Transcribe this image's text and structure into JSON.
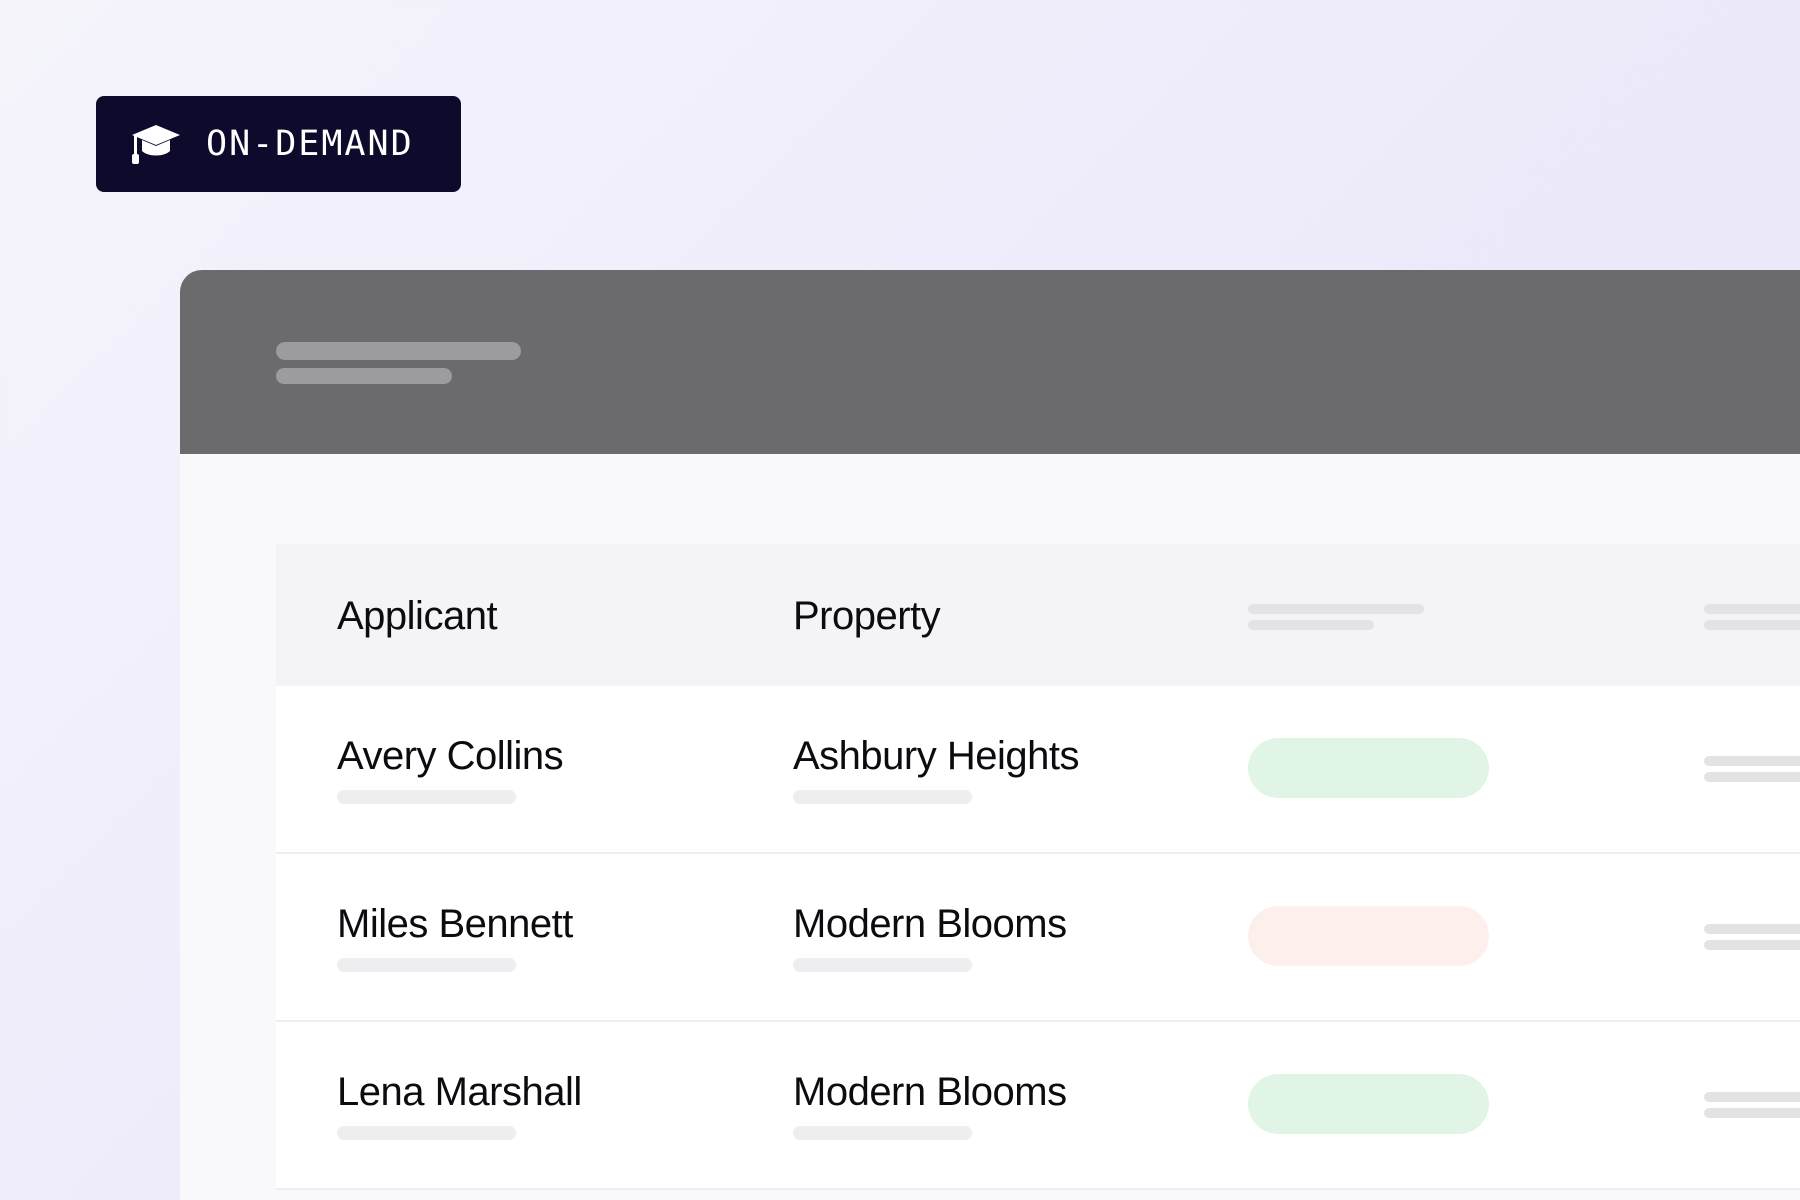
{
  "badge": {
    "icon": "graduation-cap-icon",
    "label": "ON-DEMAND"
  },
  "table": {
    "columns": [
      "Applicant",
      "Property"
    ],
    "rows": [
      {
        "applicant": "Avery Collins",
        "property": "Ashbury Heights",
        "status_color": "#e1f5e6"
      },
      {
        "applicant": "Miles Bennett",
        "property": "Modern Blooms",
        "status_color": "#fdf0ec"
      },
      {
        "applicant": "Lena Marshall",
        "property": "Modern Blooms",
        "status_color": "#e1f5e6"
      }
    ]
  },
  "colors": {
    "badge_background": "#0d0a2c",
    "window_header": "#6b6b6d",
    "status_green": "#e1f5e6",
    "status_red": "#fdf0ec"
  }
}
